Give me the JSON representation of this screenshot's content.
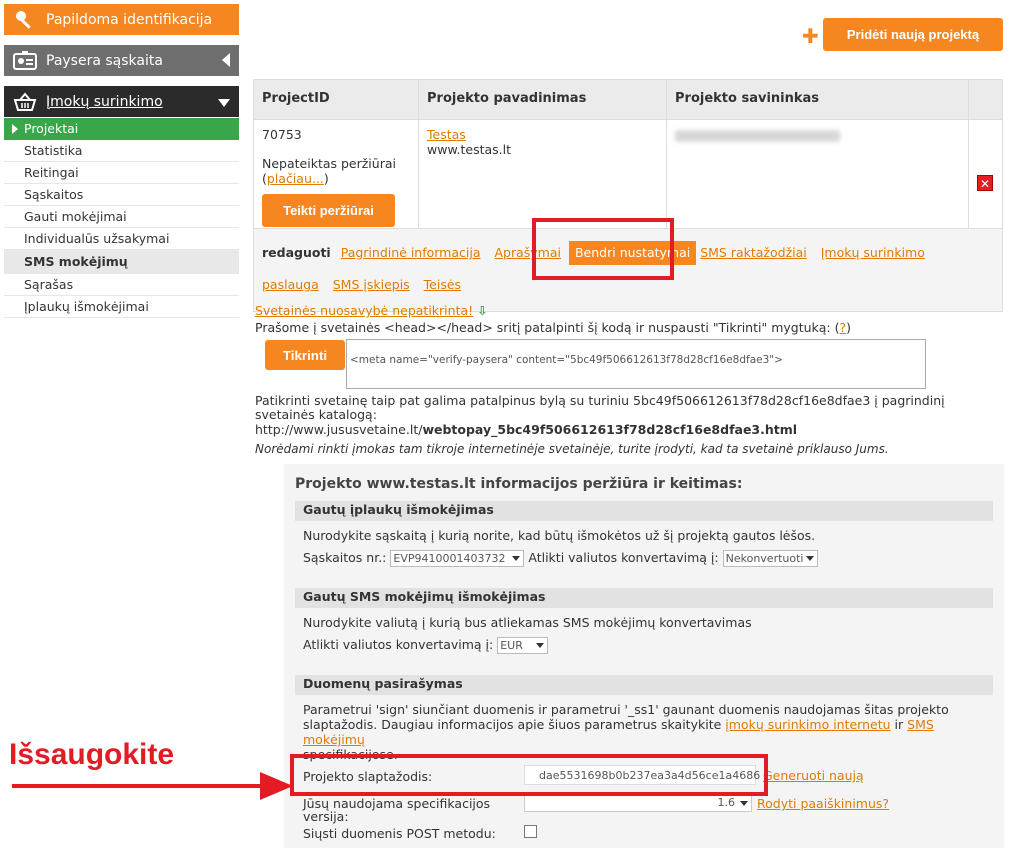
{
  "sidebar": {
    "papildoma": "Papildoma identifikacija",
    "paysera": "Paysera sąskaita",
    "imoku": "Įmokų surinkimo",
    "items": [
      {
        "label": "Projektai"
      },
      {
        "label": "Statistika"
      },
      {
        "label": "Reitingai"
      },
      {
        "label": "Sąskaitos"
      },
      {
        "label": "Gauti mokėjimai"
      },
      {
        "label": "Individualūs užsakymai"
      },
      {
        "label": "SMS mokėjimų"
      },
      {
        "label": "Sąrašas"
      },
      {
        "label": "Įplaukų išmokėjimai"
      }
    ]
  },
  "toolbar": {
    "add_label": "Pridėti naują projektą"
  },
  "table": {
    "headers": [
      "ProjectID",
      "Projekto pavadinimas",
      "Projekto savininkas"
    ],
    "row": {
      "id": "70753",
      "status": "Nepateiktas peržiūrai",
      "more_open": "(",
      "more_link": "plačiau...",
      "more_close": ")",
      "review_button": "Teikti peržiūrai",
      "name_link": "Testas",
      "url": "www.testas.lt"
    },
    "edit_label": "redaguoti",
    "tabs": [
      "Pagrindinė informacija",
      "Aprašymai",
      "Bendri nustatymai",
      "SMS raktažodžiai",
      "Įmokų surinkimo paslauga",
      "SMS įskiepis",
      "Teisės"
    ]
  },
  "verify": {
    "link": "Svetainės nuosavybė nepatikrinta!",
    "instruction": "Prašome į svetainės <head></head> sritį patalpinti šį kodą ir nuspausti \"Tikrinti\" mygtuką: (",
    "help": "?",
    "instruction_end": ")",
    "button": "Tikrinti",
    "code": "<meta name=\"verify-paysera\" content=\"5bc49f506612613f78d28cf16e8dfae3\">",
    "file_text": "Patikrinti svetainę taip pat galima patalpinus bylą su turiniu 5bc49f506612613f78d28cf16e8dfae3 į pagrindinį svetainės katalogą:",
    "file_url_prefix": "http://www.jususvetaine.lt/",
    "file_url_bold": "webtopay_5bc49f506612613f78d28cf16e8dfae3.html",
    "note": "Norėdami rinkti įmokas tam tikroje internetinėje svetainėje, turite įrodyti, kad ta svetainė priklauso Jums."
  },
  "panel": {
    "title": "Projekto www.testas.lt informacijos peržiūra ir keitimas:",
    "sec1": {
      "header": "Gautų įplaukų išmokėjimas",
      "text": "Nurodykite sąskaitą į kurią norite, kad būtų išmokėtos už šį projektą gautos lėšos.",
      "account_label": "Sąskaitos nr.:",
      "account_value": "EVP9410001403732",
      "convert_label": "Atlikti valiutos konvertavimą į:",
      "convert_value": "Nekonvertuoti"
    },
    "sec2": {
      "header": "Gautų SMS mokėjimų išmokėjimas",
      "text": "Nurodykite valiutą į kurią bus atliekamas SMS mokėjimų konvertavimas",
      "convert_label": "Atlikti valiutos konvertavimą į:",
      "convert_value": "EUR"
    },
    "sec3": {
      "header": "Duomenų pasirašymas",
      "text1": "Parametrui 'sign' siunčiant duomenis ir parametrui '_ss1' gaunant duomenis naudojamas šitas projekto",
      "text2": "slaptažodis. Daugiau informacijos apie šiuos parametrus skaitykite",
      "link1": "įmokų surinkimo internetu",
      "and": "ir",
      "link2": "SMS mokėjimų",
      "text3": "specifikacijose.",
      "password_label": "Projekto slaptažodis:",
      "password_value": "dae5531698b0b237ea3a4d56ce1a4686",
      "generate_link": "Generuoti naują",
      "spec_label": "Jūsų naudojama specifikacijos versija:",
      "spec_value": "1.6",
      "explain_link": "Rodyti paaiškinimus?",
      "post_label": "Siųsti duomenis POST metodu:"
    }
  },
  "annotation": {
    "text": "Išsaugokite"
  },
  "colors": {
    "accent": "#f68720",
    "green": "#3aa64a",
    "red": "#e31b23"
  }
}
